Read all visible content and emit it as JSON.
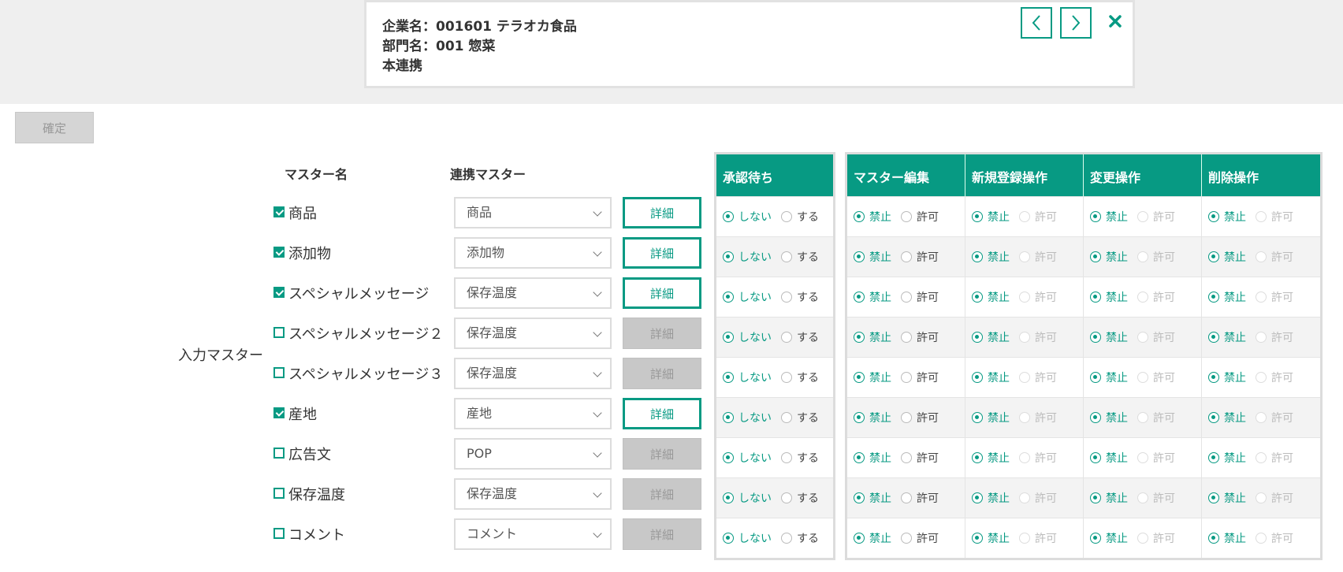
{
  "header": {
    "company": "企業名：001601 テラオカ食品",
    "department": "部門名：001 惣菜",
    "status": "本連携"
  },
  "toolbar": {
    "confirm_label": "確定"
  },
  "columns": {
    "master_name": "マスター名",
    "linked_master": "連携マスター"
  },
  "group_label": "入力マスター",
  "detail_label": "詳細",
  "approval": {
    "header": "承認待ち",
    "opt_no": "しない",
    "opt_yes": "する"
  },
  "perm_headers": [
    "マスター編集",
    "新規登録操作",
    "変更操作",
    "削除操作"
  ],
  "perm_opts": {
    "forbid": "禁止",
    "allow": "許可"
  },
  "rows": [
    {
      "name": "商品",
      "checked": true,
      "linked": "商品",
      "detail_enabled": true
    },
    {
      "name": "添加物",
      "checked": true,
      "linked": "添加物",
      "detail_enabled": true
    },
    {
      "name": "スペシャルメッセージ",
      "checked": true,
      "linked": "保存温度",
      "detail_enabled": true
    },
    {
      "name": "スペシャルメッセージ２",
      "checked": false,
      "linked": "保存温度",
      "detail_enabled": false
    },
    {
      "name": "スペシャルメッセージ３",
      "checked": false,
      "linked": "保存温度",
      "detail_enabled": false
    },
    {
      "name": "産地",
      "checked": true,
      "linked": "産地",
      "detail_enabled": true
    },
    {
      "name": "広告文",
      "checked": false,
      "linked": "POP",
      "detail_enabled": false
    },
    {
      "name": "保存温度",
      "checked": false,
      "linked": "保存温度",
      "detail_enabled": false
    },
    {
      "name": "コメント",
      "checked": false,
      "linked": "コメント",
      "detail_enabled": false
    }
  ],
  "colors": {
    "accent": "#079a83",
    "disabled": "#c8c8c8"
  }
}
